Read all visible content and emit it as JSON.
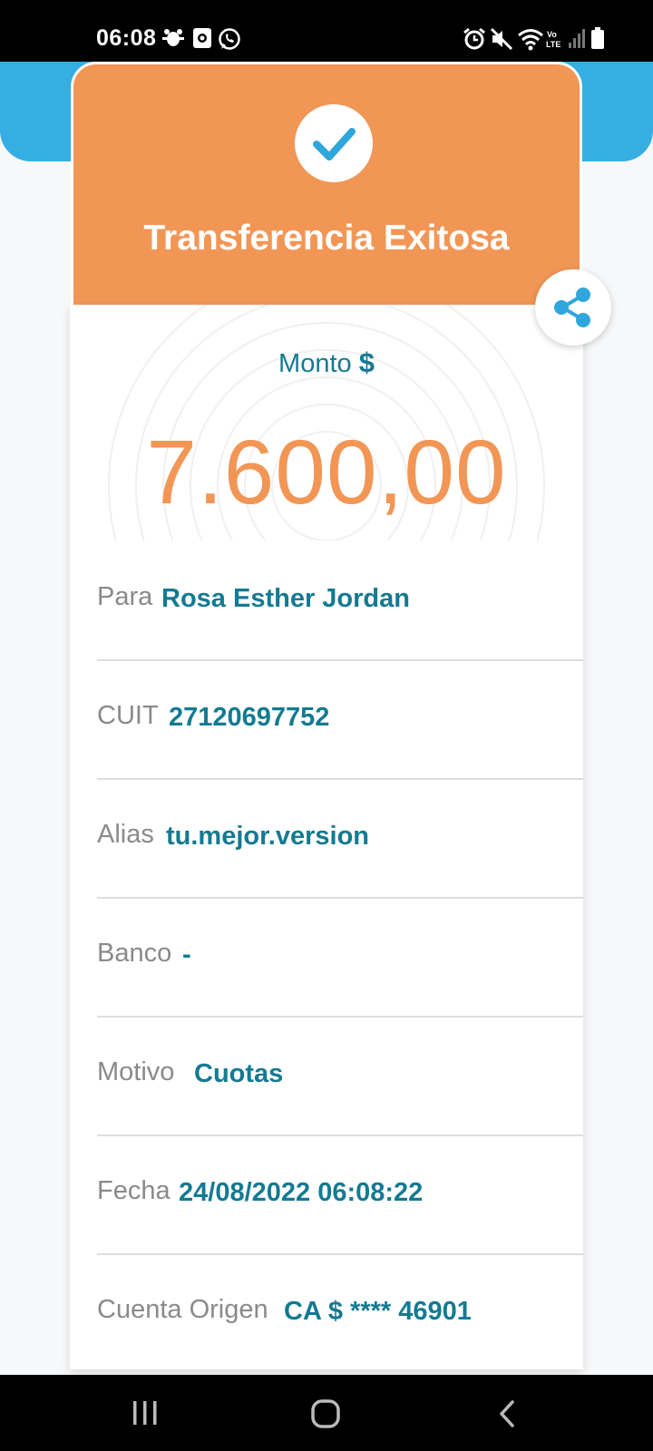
{
  "status_bar": {
    "time": "06:08",
    "icons_left": [
      "bug-icon",
      "screen-recorder-icon",
      "whatsapp-icon"
    ],
    "icons_right": [
      "alarm-icon",
      "mute-icon",
      "wifi-icon",
      "volte-icon",
      "signal-icon",
      "battery-icon"
    ]
  },
  "header": {
    "title": "Transferencia Exitosa",
    "icon": "check-icon",
    "color": "#f29656"
  },
  "share": {
    "icon": "share-icon"
  },
  "amount": {
    "label": "Monto",
    "currency": "$",
    "value": "7.600,00"
  },
  "details": [
    {
      "label": "Para",
      "value": "Rosa Esther Jordan"
    },
    {
      "label": "CUIT",
      "value": "27120697752"
    },
    {
      "label": "Alias",
      "value": "tu.mejor.version"
    },
    {
      "label": "Banco",
      "value": "-"
    },
    {
      "label": "Motivo",
      "value": "Cuotas"
    },
    {
      "label": "Fecha",
      "value": "24/08/2022 06:08:22"
    },
    {
      "label": "Cuenta Origen",
      "value": "CA $ **** 46901"
    }
  ],
  "nav_bar": {
    "icons": [
      "recent-apps-icon",
      "home-icon",
      "back-icon"
    ]
  },
  "colors": {
    "accent_blue": "#35aee2",
    "teal_text": "#147a92",
    "orange": "#f29656"
  }
}
